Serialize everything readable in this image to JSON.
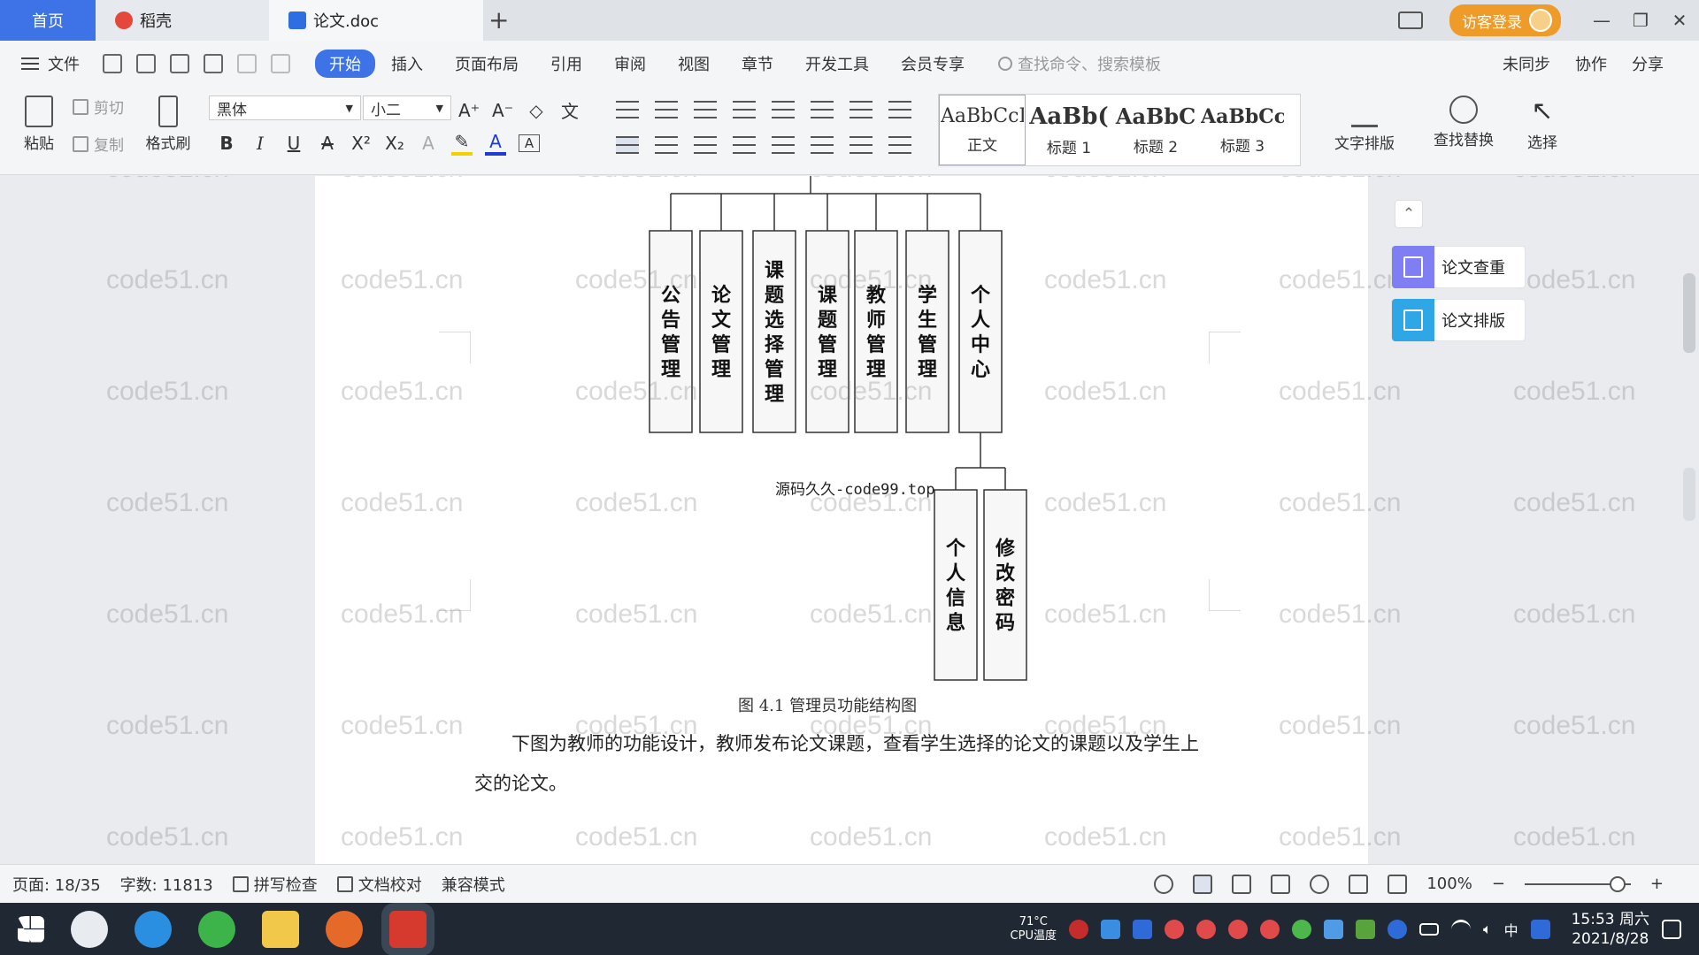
{
  "tabs": {
    "home": "首页",
    "daoke": "稻壳",
    "doc": "论文.doc",
    "add": "+"
  },
  "window": {
    "visitor_login": "访客登录"
  },
  "menu": {
    "file": "文件",
    "items": [
      "开始",
      "插入",
      "页面布局",
      "引用",
      "审阅",
      "视图",
      "章节",
      "开发工具",
      "会员专享"
    ],
    "search": "查找命令、搜索模板",
    "sync": "未同步",
    "collab": "协作",
    "share": "分享"
  },
  "ribbon": {
    "paste": "粘贴",
    "cut": "剪切",
    "copy": "复制",
    "format_painter": "格式刷",
    "font_name": "黑体",
    "font_size": "小二",
    "styles": [
      {
        "sample": "AaBbCcI",
        "label": "正文"
      },
      {
        "sample": "AaBb(",
        "label": "标题 1"
      },
      {
        "sample": "AaBbC",
        "label": "标题 2"
      },
      {
        "sample": "AaBbCcl",
        "label": "标题 3"
      }
    ],
    "text_layout": "文字排版",
    "find_replace": "查找替换",
    "select": "选择"
  },
  "document": {
    "modules": [
      "公告管理",
      "论文管理",
      "课题选择管理",
      "课题管理",
      "教师管理",
      "学生管理",
      "个人中心"
    ],
    "submodules": [
      "个人信息",
      "修改密码"
    ],
    "source_note": "源码久久-code99.top",
    "caption": "图 4.1  管理员功能结构图",
    "paragraph": "下图为教师的功能设计，教师发布论文课题，查看学生选择的论文的课题以及学生上交的论文。"
  },
  "watermark_text": "code51.cn",
  "side_panel": {
    "check": "论文查重",
    "layout": "论文排版"
  },
  "status": {
    "page": "页面: 18/35",
    "words": "字数: 11813",
    "spell": "拼写检查",
    "proof": "文档校对",
    "compat": "兼容模式",
    "zoom": "100%"
  },
  "taskbar": {
    "cpu_temp": "71°C",
    "cpu_label": "CPU温度",
    "ime": "中",
    "time": "15:53 周六",
    "date": "2021/8/28"
  },
  "colors": {
    "accent": "#3d73e6",
    "login": "#ef9b2a"
  }
}
